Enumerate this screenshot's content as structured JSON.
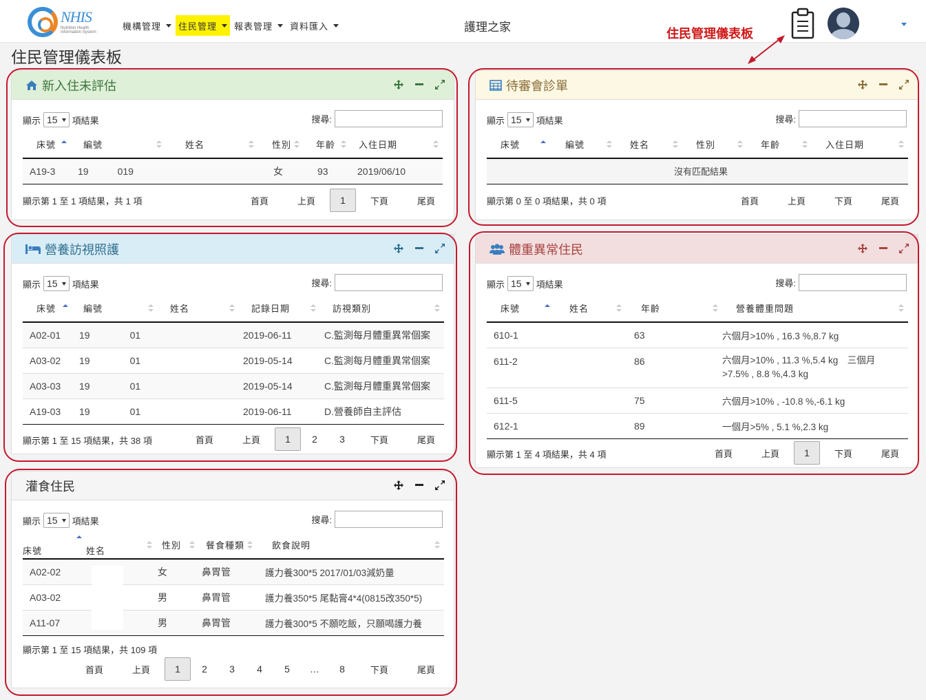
{
  "header": {
    "logo": {
      "brand": "NHIS",
      "sub": "Nutrition Health Information System"
    },
    "nav": [
      {
        "label": "機構管理",
        "active": false
      },
      {
        "label": "住民管理",
        "active": true
      },
      {
        "label": "報表管理",
        "active": false
      },
      {
        "label": "資料匯入",
        "active": false
      }
    ],
    "app_title": "護理之家",
    "callout": "住民管理儀表板"
  },
  "page_title": "住民管理儀表板",
  "common": {
    "show": "顯示",
    "results": "項結果",
    "search": "搜尋:",
    "length": "15",
    "first": "首頁",
    "prev": "上頁",
    "next": "下頁",
    "last": "尾頁"
  },
  "panels": {
    "new_residents": {
      "title": "新入住未評估",
      "headers": [
        "床號",
        "編號",
        "姓名",
        "性別",
        "年齡",
        "入住日期"
      ],
      "rows": [
        [
          "A19-3",
          "19",
          "019",
          "",
          "女",
          "93",
          "2019/06/10"
        ]
      ],
      "info": "顯示第 1 至 1 項結果，共 1 項",
      "pages": [
        "1"
      ],
      "current": "1"
    },
    "pending": {
      "title": "待審會診單",
      "headers": [
        "床號",
        "編號",
        "姓名",
        "性別",
        "年齡",
        "入住日期"
      ],
      "empty": "沒有匹配結果",
      "info": "顯示第 0 至 0 項結果，共 0 項"
    },
    "nutrition": {
      "title": "營養訪視照護",
      "headers": [
        "床號",
        "編號",
        "姓名",
        "記錄日期",
        "訪視類別"
      ],
      "rows": [
        [
          "A02-01",
          "19",
          "01",
          "",
          "2019-06-11",
          "C.監測每月體重異常個案"
        ],
        [
          "A03-02",
          "19",
          "01",
          "",
          "2019-05-14",
          "C.監測每月體重異常個案"
        ],
        [
          "A03-03",
          "19",
          "01",
          "",
          "2019-05-14",
          "C.監測每月體重異常個案"
        ],
        [
          "A19-03",
          "19",
          "01",
          "",
          "2019-06-11",
          "D.營養師自主評估"
        ]
      ],
      "info": "顯示第 1 至 15 項結果，共 38 項",
      "pages": [
        "1",
        "2",
        "3"
      ],
      "current": "1"
    },
    "weight": {
      "title": "體重異常住民",
      "headers": [
        "床號",
        "姓名",
        "年齡",
        "營養體重問題"
      ],
      "rows": [
        [
          "610-1",
          "",
          "63",
          "六個月>10% , 16.3 %,8.7 kg"
        ],
        [
          "611-2",
          "",
          "86",
          "六個月>10% , 11.3 %,5.4 kg　三個月>7.5% , 8.8 %,4.3 kg"
        ],
        [
          "611-5",
          "",
          "75",
          "六個月>10% , -10.8 %,-6.1 kg"
        ],
        [
          "612-1",
          "",
          "89",
          "一個月>5% , 5.1 %,2.3 kg"
        ]
      ],
      "info": "顯示第 1 至 4 項結果，共 4 項",
      "pages": [
        "1"
      ],
      "current": "1"
    },
    "tube": {
      "title": "灌食住民",
      "headers": [
        "床號",
        "姓名",
        "性別",
        "餐食種類",
        "飲食說明"
      ],
      "rows": [
        [
          "A02-02",
          "",
          "女",
          "鼻胃管",
          "護力養300*5 2017/01/03減奶量"
        ],
        [
          "A03-02",
          "",
          "男",
          "鼻胃管",
          "護力養350*5 尾黏膏4*4(0815改350*5)"
        ],
        [
          "A11-07",
          "",
          "男",
          "鼻胃管",
          "護力養300*5 不願吃飯，只願喝護力養"
        ]
      ],
      "info": "顯示第 1 至 15 項結果，共 109 項",
      "pages": [
        "1",
        "2",
        "3",
        "4",
        "5",
        "…",
        "8"
      ],
      "current": "1"
    }
  },
  "colors": {
    "highlight": "#fff200",
    "callout": "#d01818",
    "ring": "#c4182c"
  }
}
